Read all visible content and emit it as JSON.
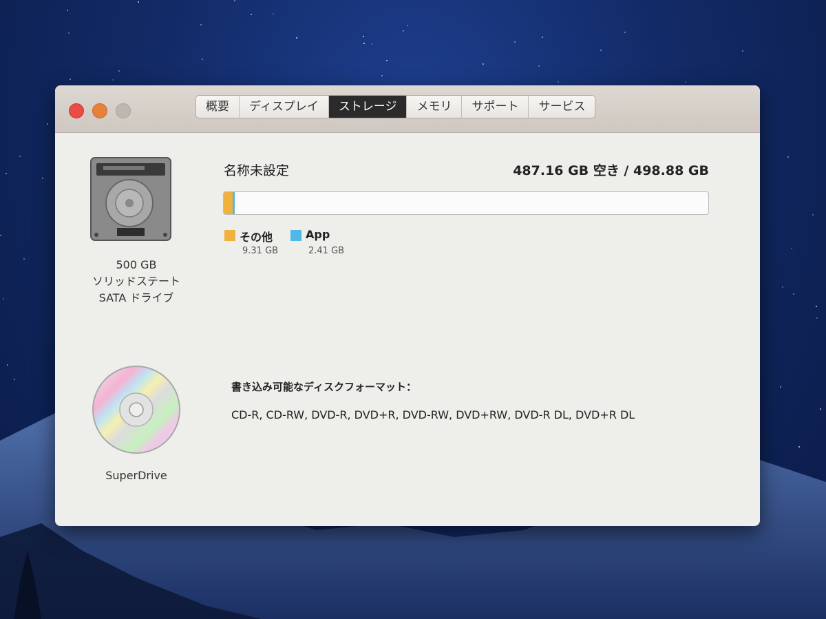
{
  "tabs": [
    {
      "label": "概要",
      "active": false
    },
    {
      "label": "ディスプレイ",
      "active": false
    },
    {
      "label": "ストレージ",
      "active": true
    },
    {
      "label": "メモリ",
      "active": false
    },
    {
      "label": "サポート",
      "active": false
    },
    {
      "label": "サービス",
      "active": false
    }
  ],
  "storage_drive": {
    "label_lines": [
      "500 GB",
      "ソリッドステート",
      "SATA ドライブ"
    ],
    "name": "名称未設定",
    "free_text": "487.16 GB 空き / 498.88 GB",
    "total_gb": 498.88,
    "usage": [
      {
        "name": "その他",
        "size_text": "9.31 GB",
        "gb": 9.31,
        "color": "#f0b23c"
      },
      {
        "name": "App",
        "size_text": "2.41 GB",
        "gb": 2.41,
        "color": "#4fb8e6"
      }
    ]
  },
  "optical_drive": {
    "label": "SuperDrive",
    "formats_title": "書き込み可能なディスクフォーマット：",
    "formats": "CD-R, CD-RW, DVD-R, DVD+R, DVD-RW, DVD+RW, DVD-R DL, DVD+R DL"
  },
  "icons": {
    "close": "close-button",
    "minimize": "minimize-button",
    "zoom": "zoom-button",
    "hdd": "hard-drive-icon",
    "cd": "optical-disc-icon"
  }
}
